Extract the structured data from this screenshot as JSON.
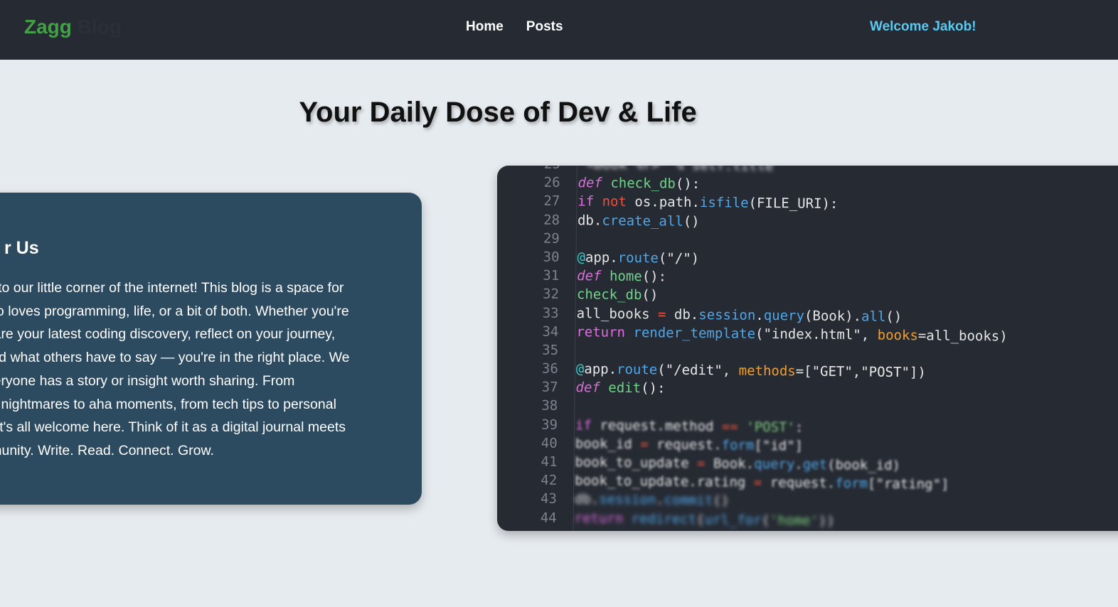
{
  "nav": {
    "brand_primary": "Zagg",
    "brand_secondary": "Blog",
    "links": [
      "Home",
      "Posts"
    ],
    "welcome": "Welcome Jakob!"
  },
  "main": {
    "headline": "Your Daily Dose of Dev & Life"
  },
  "about": {
    "title": "r Us",
    "lines": [
      "ne to our little corner of the internet! This blog is a space for",
      "who loves programming, life, or a bit of both. Whether you're",
      " share your latest coding discovery, reflect on your journey,",
      "read what others have to say — you're in the right place. We",
      " everyone has a story or insight worth sharing. From",
      "ing nightmares to aha moments, from tech tips to personal",
      " — it's all welcome here. Think of it as a digital journal meets",
      "mmunity. Write. Read. Connect. Grow."
    ]
  },
  "code_image": {
    "lines": [
      {
        "n": "25",
        "text": "       \"<Book %r>\" % self.title"
      },
      {
        "n": "26",
        "text": "def check_db():"
      },
      {
        "n": "27",
        "text": "    if not os.path.isfile(FILE_URI):"
      },
      {
        "n": "28",
        "text": "        db.create_all()"
      },
      {
        "n": "29",
        "text": ""
      },
      {
        "n": "30",
        "text": "@app.route(\"/\")"
      },
      {
        "n": "31",
        "text": "def home():"
      },
      {
        "n": "32",
        "text": "    check_db()"
      },
      {
        "n": "33",
        "text": "    all_books = db.session.query(Book).all()"
      },
      {
        "n": "34",
        "text": "    return render_template(\"index.html\", books=all_books)"
      },
      {
        "n": "35",
        "text": ""
      },
      {
        "n": "36",
        "text": "@app.route(\"/edit\", methods=[\"GET\",\"POST\"])"
      },
      {
        "n": "37",
        "text": "def edit():"
      },
      {
        "n": "38",
        "text": ""
      },
      {
        "n": "39",
        "text": "    if request.method == 'POST':"
      },
      {
        "n": "40",
        "text": "        book_id = request.form[\"id\"]"
      },
      {
        "n": "41",
        "text": "        book_to_update = Book.query.get(book_id)"
      },
      {
        "n": "42",
        "text": "        book_to_update.rating = request.form[\"rating\"]"
      },
      {
        "n": "43",
        "text": "        db.session.commit()"
      },
      {
        "n": "44",
        "text": "        return redirect(url_for('home'))"
      }
    ]
  },
  "colors": {
    "nav_bg": "#262b33",
    "brand_green": "#43a047",
    "welcome_blue": "#5cc8f0",
    "page_bg": "#e6ebef",
    "about_bg": "#2c4a60",
    "code_bg": "#262a33"
  }
}
